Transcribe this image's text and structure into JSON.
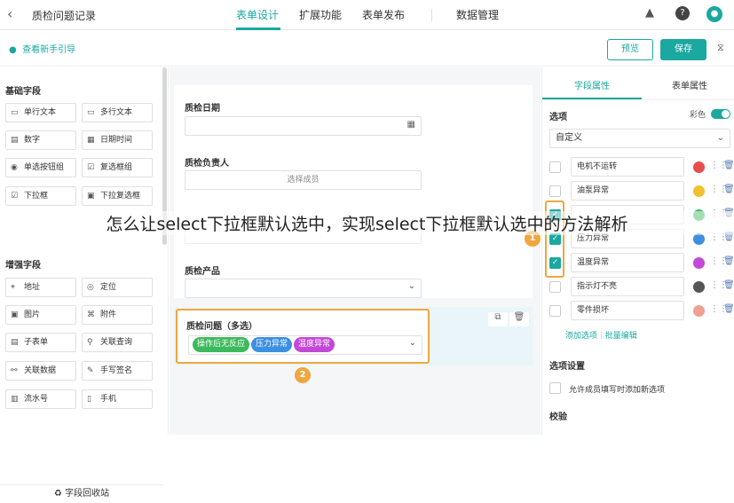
{
  "header": {
    "back_icon": "chevron-left-icon",
    "title": "质检问题记录",
    "tabs": [
      {
        "label": "表单设计",
        "active": true
      },
      {
        "label": "扩展功能",
        "active": false
      },
      {
        "label": "表单发布",
        "active": false
      },
      {
        "label": "数据管理",
        "active": false
      }
    ],
    "icons": [
      "rocket-icon",
      "help-icon",
      "avatar-icon"
    ]
  },
  "subbar": {
    "guide_icon": "pin-icon",
    "guide_label": "查看新手引导",
    "preview_label": "预览",
    "save_label": "保存",
    "share_icon": "share-icon"
  },
  "left": {
    "basic_title": "基础字段",
    "basic_items": [
      {
        "label": "单行文本",
        "icon": "T"
      },
      {
        "label": "多行文本",
        "icon": "≡"
      },
      {
        "label": "数字",
        "icon": "#"
      },
      {
        "label": "日期时间",
        "icon": "▦"
      },
      {
        "label": "单选按钮组",
        "icon": "◉"
      },
      {
        "label": "复选框组",
        "icon": "☑"
      },
      {
        "label": "下拉框",
        "icon": "▾"
      },
      {
        "label": "下拉复选框",
        "icon": "▾"
      }
    ],
    "enhanced_title": "增强字段",
    "enhanced_items": [
      {
        "label": "地址",
        "icon": "⌖"
      },
      {
        "label": "定位",
        "icon": "◎"
      },
      {
        "label": "图片",
        "icon": "▣"
      },
      {
        "label": "附件",
        "icon": "⎘"
      },
      {
        "label": "子表单",
        "icon": "▤"
      },
      {
        "label": "关联查询",
        "icon": "⚲"
      },
      {
        "label": "关联数据",
        "icon": "⛓"
      },
      {
        "label": "手写签名",
        "icon": "✎"
      },
      {
        "label": "流水号",
        "icon": "№"
      },
      {
        "label": "手机",
        "icon": "▯"
      }
    ],
    "recycle_label": "字段回收站"
  },
  "canvas": {
    "field_date_label": "质检日期",
    "field_owner_label": "质检负责人",
    "field_owner_placeholder": "选择成员",
    "field_product_label": "质检产品",
    "field_issue_label": "质检问题（多选）",
    "issue_tags": [
      {
        "text": "操作后无反应",
        "color": "#3cb95c"
      },
      {
        "text": "压力异常",
        "color": "#3d8fe0"
      },
      {
        "text": "温度异常",
        "color": "#c448d8"
      }
    ],
    "badge_1": "1",
    "badge_2": "2"
  },
  "right": {
    "tabs": [
      {
        "label": "字段属性",
        "active": true
      },
      {
        "label": "表单属性",
        "active": false
      }
    ],
    "options_title": "选项",
    "color_label": "彩色",
    "select_mode": "自定义",
    "options": [
      {
        "text": "电机不运转",
        "checked": false,
        "color": "#e84c4c"
      },
      {
        "text": "油泵异常",
        "checked": false,
        "color": "#f0c030"
      },
      {
        "text": "",
        "checked": true,
        "color": "#3cb95c"
      },
      {
        "text": "压力异常",
        "checked": true,
        "color": "#3d8fe0"
      },
      {
        "text": "温度异常",
        "checked": true,
        "color": "#c448d8"
      },
      {
        "text": "指示灯不亮",
        "checked": false,
        "color": "#555555"
      },
      {
        "text": "零件损坏",
        "checked": false,
        "color": "#f0a090"
      }
    ],
    "add_option": "添加选项",
    "batch_edit": "批量编辑",
    "option_settings_title": "选项设置",
    "allow_add_label": "允许成员填写时添加新选项",
    "validation_title": "校验"
  },
  "overlay": {
    "caption": "怎么让select下拉框默认选中，实现select下拉框默认选中的方法解析"
  },
  "colors": {
    "accent": "#1aa8a0",
    "highlight": "#f0a640"
  }
}
